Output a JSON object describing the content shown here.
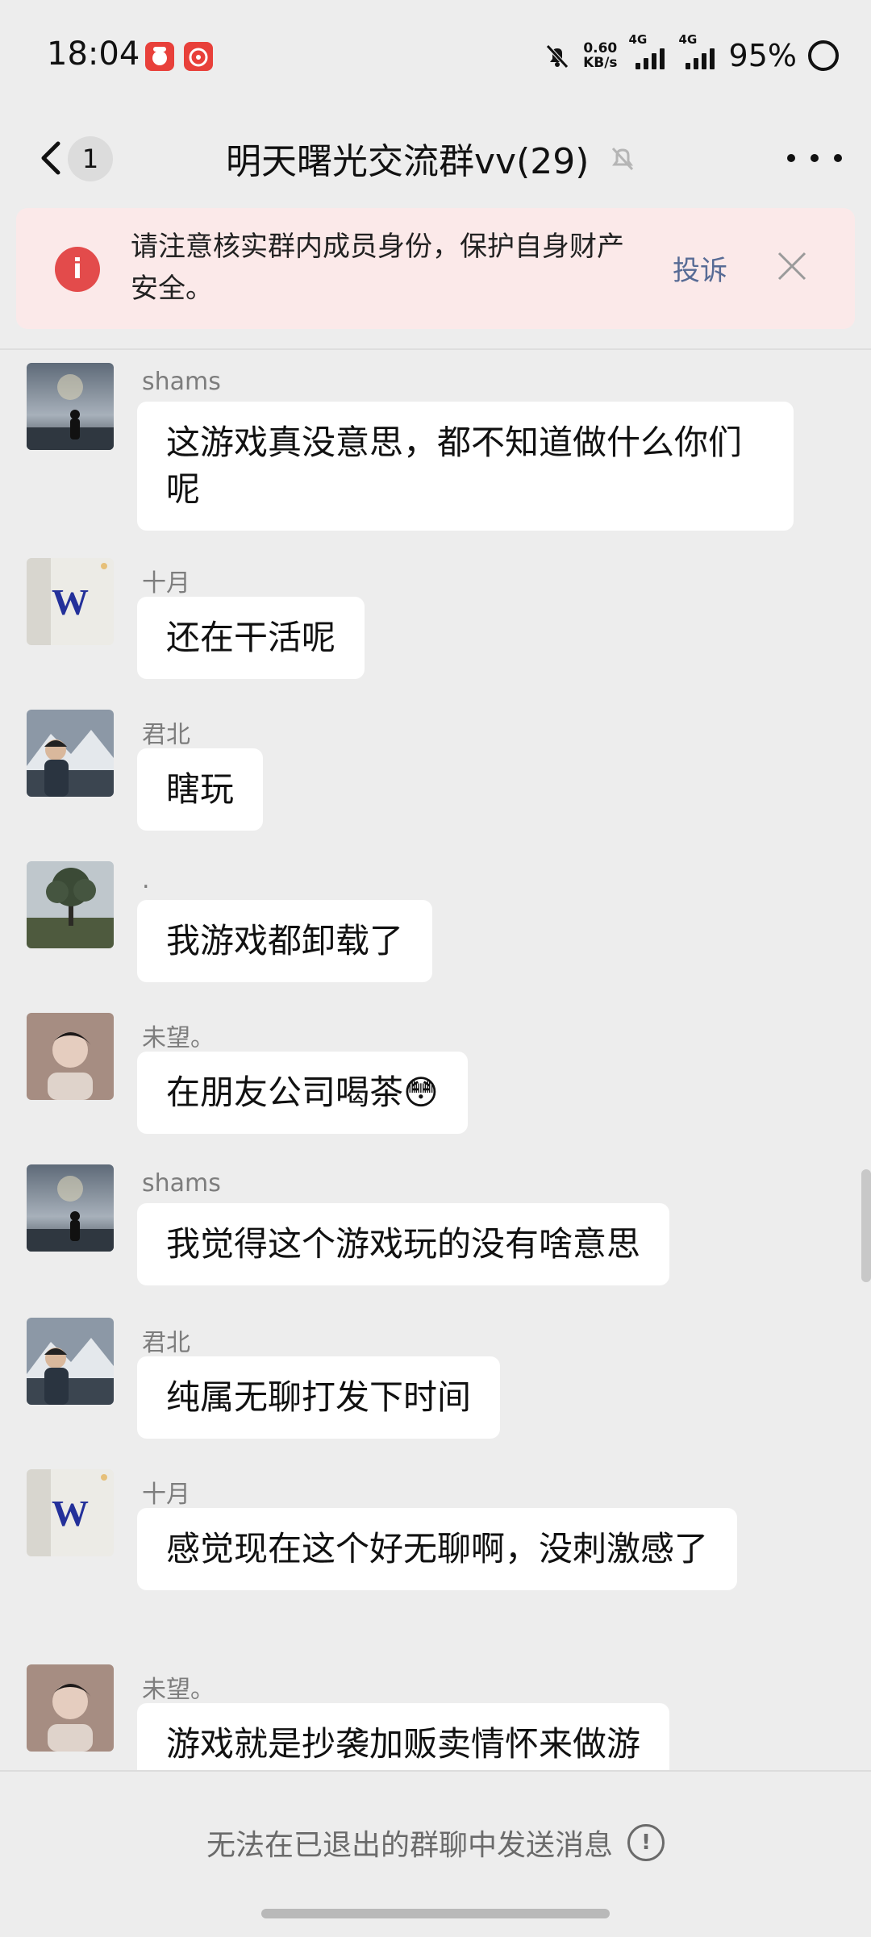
{
  "status_bar": {
    "time": "18:04",
    "net_speed_value": "0.60",
    "net_speed_unit": "KB/s",
    "sim1": "4G",
    "sim2": "4G",
    "battery": "95%"
  },
  "header": {
    "unread_count": "1",
    "title": "明天曙光交流群vv(29)"
  },
  "banner": {
    "text": "请注意核实群内成员身份，保护自身财产安全。",
    "action": "投诉",
    "accent": "#e34b4b",
    "link_color": "#576b95"
  },
  "messages": [
    {
      "name": "shams",
      "avatar": "silhouette-fireworks",
      "text": "这游戏真没意思，都不知道做什么你们呢"
    },
    {
      "name": "十月",
      "avatar": "w-logo",
      "text": "还在干活呢"
    },
    {
      "name": "君北",
      "avatar": "man-mountain",
      "text": "瞎玩"
    },
    {
      "name": ".",
      "avatar": "tree",
      "text": "我游戏都卸载了"
    },
    {
      "name": "未望。",
      "avatar": "man-portrait",
      "text": "在朋友公司喝茶😳"
    },
    {
      "name": "shams",
      "avatar": "silhouette-fireworks",
      "text": "我觉得这个游戏玩的没有啥意思"
    },
    {
      "name": "君北",
      "avatar": "man-mountain",
      "text": "纯属无聊打发下时间"
    },
    {
      "name": "十月",
      "avatar": "w-logo",
      "text": "感觉现在这个好无聊啊，没刺激感了"
    },
    {
      "name": "未望。",
      "avatar": "man-portrait",
      "text": "游戏就是抄袭加贩卖情怀来做游"
    }
  ],
  "footer": {
    "text": "无法在已退出的群聊中发送消息"
  }
}
